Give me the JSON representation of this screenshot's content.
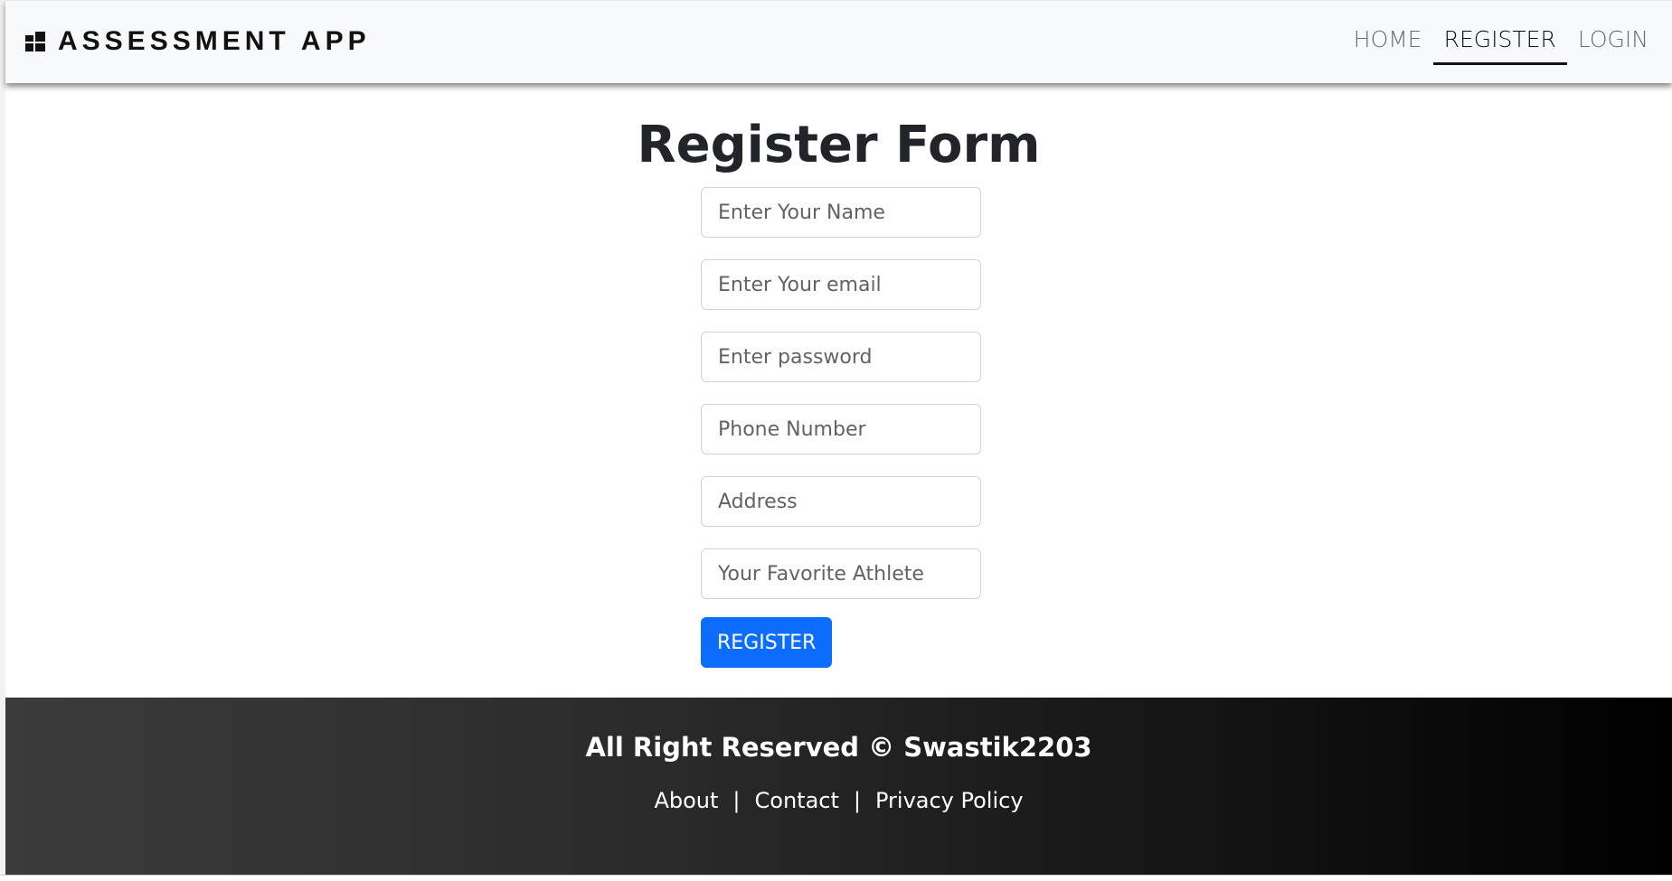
{
  "navbar": {
    "brand": "ASSESSMENT APP",
    "links": [
      "HOME",
      "REGISTER",
      "LOGIN"
    ],
    "active": "REGISTER"
  },
  "form": {
    "title": "Register Form",
    "fields": {
      "name": "Enter Your Name",
      "email": "Enter Your email",
      "password": "Enter password",
      "phone": "Phone Number",
      "address": "Address",
      "athlete": "Your Favorite Athlete"
    },
    "submit_label": "REGISTER"
  },
  "footer": {
    "copyright": "All Right Reserved © Swastik2203",
    "links": [
      "About",
      "Contact",
      "Privacy Policy"
    ],
    "separator": "|"
  },
  "colors": {
    "primary": "#0d6efd",
    "navbar_bg": "#f8f9fa",
    "footer_start": "#3b3b3b",
    "footer_end": "#000000"
  },
  "icons": {
    "brand": "dashboard-grid-icon"
  }
}
